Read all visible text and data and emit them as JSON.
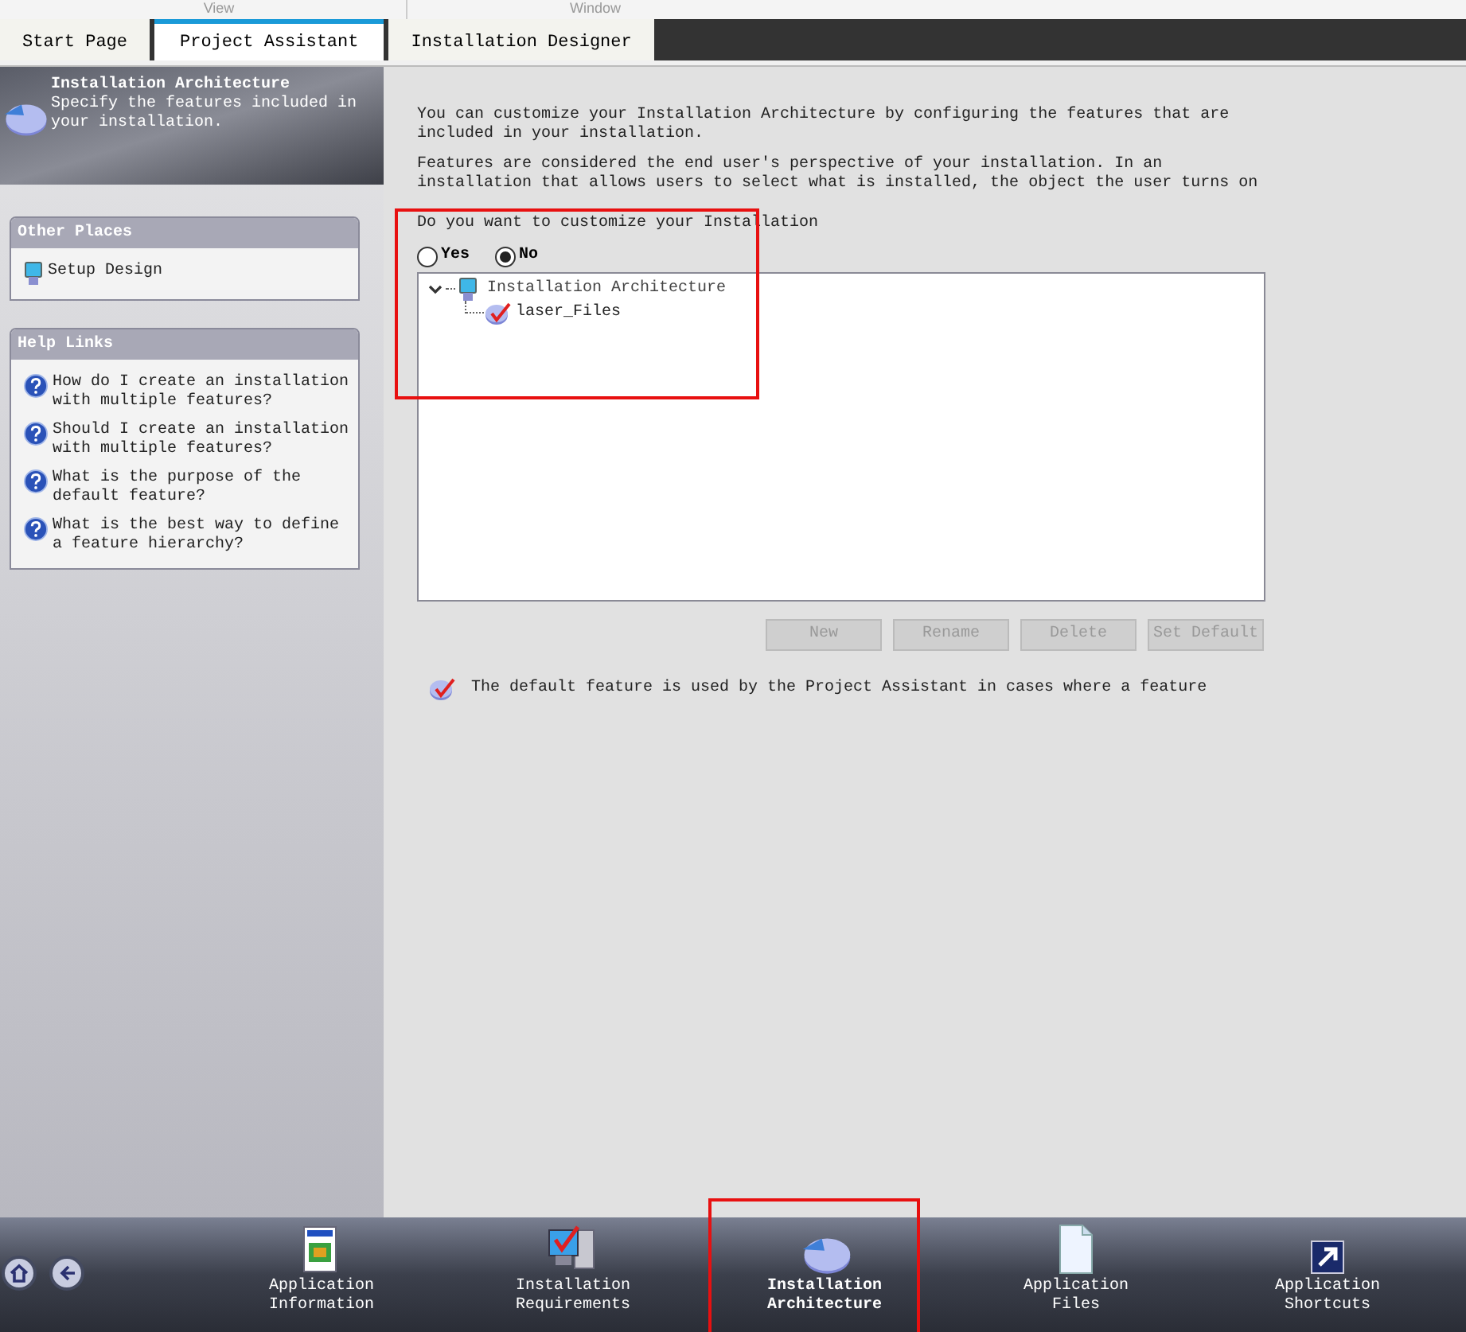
{
  "menu": [
    "View",
    "Window"
  ],
  "tabs": [
    {
      "label": "Start Page",
      "selected": false
    },
    {
      "label": "Project Assistant",
      "selected": true
    },
    {
      "label": "Installation Designer",
      "selected": false
    }
  ],
  "sidebar": {
    "header": {
      "title": "Installation Architecture",
      "subtitle": "Specify the features included in your installation."
    },
    "panels": [
      {
        "title": "Other Places",
        "items": [
          {
            "kind": "place",
            "label": "Setup Design"
          }
        ]
      },
      {
        "title": "Help Links",
        "items": [
          {
            "kind": "help",
            "label": "How do I create an installation with multiple features?"
          },
          {
            "kind": "help",
            "label": "Should I create an installation with multiple features?"
          },
          {
            "kind": "help",
            "label": "What is the purpose of the default feature?"
          },
          {
            "kind": "help",
            "label": "What is the best way to define a feature hierarchy?"
          }
        ]
      }
    ]
  },
  "main": {
    "paragraphs": [
      "You can customize your Installation Architecture by configuring the features that are included in your installation.",
      "Features are considered the end user's perspective of your installation. In an installation that allows users to select what is installed, the object the user turns on"
    ],
    "question": "Do you want to customize your Installation",
    "highlighted": true,
    "options": [
      {
        "label": "Yes",
        "selected": false
      },
      {
        "label": "No",
        "selected": true
      }
    ],
    "tree": [
      {
        "label": "Installation Architecture",
        "expanded": true,
        "children": [
          {
            "label": "laser_Files"
          }
        ]
      }
    ],
    "buttons": [
      {
        "label": "New",
        "disabled": true
      },
      {
        "label": "Rename",
        "disabled": true
      },
      {
        "label": "Delete",
        "disabled": true
      },
      {
        "label": "Set Default",
        "disabled": true
      }
    ],
    "note": "The default feature is used by the Project Assistant in cases where a feature"
  },
  "nav": {
    "items": [
      {
        "label": "Application Information",
        "kind": "info",
        "selected": false,
        "highlighted": false
      },
      {
        "label": "Installation Requirements",
        "kind": "requirements",
        "selected": false,
        "highlighted": false
      },
      {
        "label": "Installation Architecture",
        "kind": "architecture",
        "selected": true,
        "highlighted": true
      },
      {
        "label": "Application Files",
        "kind": "files",
        "selected": false,
        "highlighted": false
      },
      {
        "label": "Application Shortcuts",
        "kind": "shortcuts",
        "selected": false,
        "highlighted": false
      }
    ]
  }
}
